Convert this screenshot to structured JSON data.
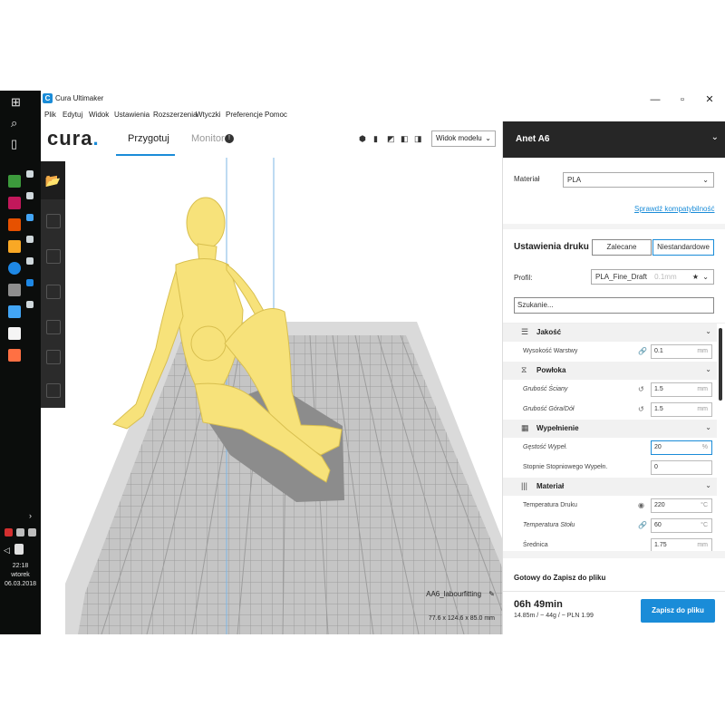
{
  "window": {
    "title": "Cura Ultimaker",
    "minimize": "—",
    "maximize": "▫",
    "close": "✕"
  },
  "menu": [
    "Plik",
    "Edytuj",
    "Widok",
    "Ustawienia",
    "Rozszerzenia",
    "Wtyczki",
    "Preferencje",
    "Pomoc"
  ],
  "header": {
    "logo": "cura",
    "logo_dot": ".",
    "tab_prepare": "Przygotuj",
    "tab_monitor": "Monitor",
    "view_mode": "Widok modelu"
  },
  "taskbar": {
    "time": "22:18",
    "day": "wtorek",
    "date": "06.03.2018"
  },
  "viewport": {
    "model_name": "AA6_labourfitting",
    "model_dims": "77.6 x 124.6 x 85.0 mm"
  },
  "panel": {
    "printer": "Anet A6",
    "material_label": "Materiał",
    "material_value": "PLA",
    "compat_link": "Sprawdź kompatybilność",
    "print_settings": "Ustawienia druku",
    "mode_recommended": "Zalecane",
    "mode_custom": "Niestandardowe",
    "profile_label": "Profil:",
    "profile_value": "PLA_Fine_Draft",
    "profile_sub": "0.1mm",
    "search_placeholder": "Szukanie...",
    "categories": {
      "quality": "Jakość",
      "shell": "Powłoka",
      "infill": "Wypełnienie",
      "material": "Materiał"
    },
    "settings": {
      "layer_height": {
        "label": "Wysokość Warstwy",
        "value": "0.1",
        "unit": "mm"
      },
      "wall_thickness": {
        "label": "Grubość Ściany",
        "value": "1.5",
        "unit": "mm"
      },
      "top_bottom": {
        "label": "Grubość Góra/Dół",
        "value": "1.5",
        "unit": "mm"
      },
      "infill_density": {
        "label": "Gęstość Wypeł.",
        "value": "20",
        "unit": "%"
      },
      "gradual_infill": {
        "label": "Stopnie Stopniowego Wypełn.",
        "value": "0",
        "unit": ""
      },
      "print_temp": {
        "label": "Temperatura Druku",
        "value": "220",
        "unit": "°C"
      },
      "bed_temp": {
        "label": "Temperatura Stołu",
        "value": "60",
        "unit": "°C"
      },
      "diameter": {
        "label": "Średnica",
        "value": "1.75",
        "unit": "mm"
      }
    },
    "output_title": "Gotowy do Zapisz do pliku",
    "print_time": "06h 49min",
    "print_details": "14.85m / ~ 44g / ~ PLN 1.99",
    "save_button": "Zapisz do pliku"
  },
  "colors": {
    "accent": "#1a8cd8",
    "model": "#f7e27a",
    "header_dark": "#262626"
  },
  "icons": [
    "windows-icon",
    "search-icon",
    "task-view-icon",
    "open-file-icon",
    "quality-icon",
    "shell-icon",
    "infill-icon",
    "material-icon",
    "link-icon",
    "reset-icon",
    "star-icon"
  ]
}
